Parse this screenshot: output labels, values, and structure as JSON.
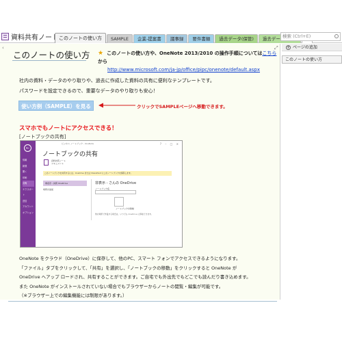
{
  "notebook": {
    "name": "資料共有ノート",
    "caret": "▼"
  },
  "tabs": [
    {
      "label": "このノートの使い方",
      "color": "#f3f3f3",
      "active": true
    },
    {
      "label": "SAMPLE",
      "color": "#cfcfcf"
    },
    {
      "label": "企業-提案書",
      "color": "#9ed0ea"
    },
    {
      "label": "議事録",
      "color": "#a5c9e0"
    },
    {
      "label": "要件書類",
      "color": "#9fcfe8"
    },
    {
      "label": "過去データ(保管)",
      "color": "#a8d58a"
    },
    {
      "label": "過去データ(保管)",
      "color": "#b3de9a"
    },
    {
      "label": "+",
      "color": "#ffffff",
      "add": true
    }
  ],
  "search": {
    "placeholder": "検索 (Ctrl+E)"
  },
  "page": {
    "title": "このノートの使い方",
    "note_line1_pre": "このノートの使い方や、OneNote 2013/2010 の操作手順については",
    "note_link": "こちら",
    "note_line1_post": "から",
    "note_url": "http://www.microsoft.com/ja-jp/office/pipc/onenote/default.aspx",
    "intro_line1": "社内の資料・データのやり取りや、過去に作成した資料の共有に便利なテンプレートです。",
    "intro_line2": "パスワードを設定できるので、重要なデータのやり取りも安心！",
    "sample_button": "使い方例（SAMPLE）を見る",
    "arrow_label": "クリックでSAMPLEページへ移動できます。",
    "red_heading": "スマホでもノートにアクセスできる！",
    "sub_heading": "[ノートブックの共有]",
    "paragraph": [
      "OneNote をクラウド（OneDrive）に保存して、他のPC、スマート フォンでアクセスできるようになります。",
      "「ファイル」タブをクリックして、「共有」を選択し、「ノートブックの移動」をクリックすると OneNote が",
      "OneDrive へアップ ロードされ、共有することができます。ご自宅でも外出先でもどこでも読んだり書き込めます。",
      "また OneNote がインストールされていない場合でもブラウザーからノートの閲覧・編集が可能です。",
      "（※ブラウザー上での編集機能には制限があります。）"
    ]
  },
  "screenshot": {
    "window_title": "ビジネス ノートブック - OneNote",
    "heading": "ノートブックの共有",
    "doc_name": "資料共有ノート",
    "doc_sub": "ドキュメント",
    "menu": [
      "情報",
      "新規",
      "開く",
      "印刷",
      "共有",
      "エクスポート",
      "送信",
      "アカウント",
      "オプション"
    ],
    "selected_menu": "共有",
    "info_bar": "このノートブックを共有するには、OneDrive または SharePoint にこのノートブックを保存します。",
    "onedrive_item": "非表示 - 共有 OneDrive",
    "add_place": "場所の追加",
    "right_title": "非表示 - さんの OneDrive",
    "name_label": "ノートブック名",
    "create_label": "ノートブックの移動",
    "footer": "他の場所で作業する場合は、いつでも OneDrive に移動できます。"
  },
  "pane": {
    "add_page": "ページの追加",
    "pages": [
      "このノートの使い方"
    ]
  }
}
